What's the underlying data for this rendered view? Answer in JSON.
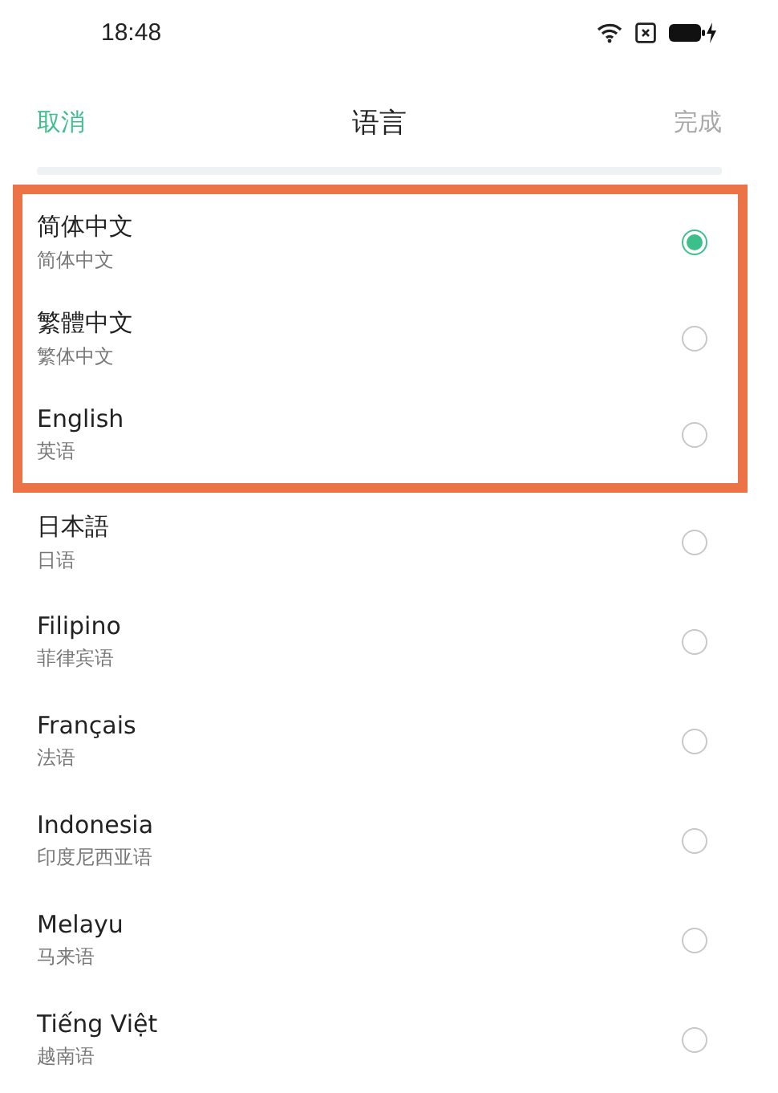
{
  "status_bar": {
    "time": "18:48"
  },
  "nav": {
    "cancel": "取消",
    "title": "语言",
    "done": "完成",
    "done_disabled": true
  },
  "languages": [
    {
      "name": "简体中文",
      "subtitle": "简体中文",
      "selected": true,
      "highlighted": true
    },
    {
      "name": "繁體中文",
      "subtitle": "繁体中文",
      "selected": false,
      "highlighted": true
    },
    {
      "name": "English",
      "subtitle": "英语",
      "selected": false,
      "highlighted": true
    },
    {
      "name": "日本語",
      "subtitle": "日语",
      "selected": false,
      "highlighted": false
    },
    {
      "name": "Filipino",
      "subtitle": "菲律宾语",
      "selected": false,
      "highlighted": false
    },
    {
      "name": "Français",
      "subtitle": "法语",
      "selected": false,
      "highlighted": false
    },
    {
      "name": "Indonesia",
      "subtitle": "印度尼西亚语",
      "selected": false,
      "highlighted": false
    },
    {
      "name": "Melayu",
      "subtitle": "马来语",
      "selected": false,
      "highlighted": false
    },
    {
      "name": "Tiếng Việt",
      "subtitle": "越南语",
      "selected": false,
      "highlighted": false
    }
  ]
}
